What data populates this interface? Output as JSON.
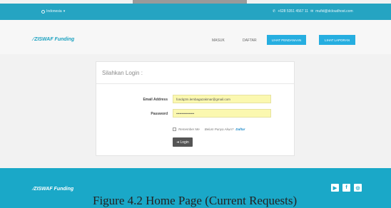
{
  "topbar": {
    "language": "Indonesia",
    "phone": "+628 5351 4567 11",
    "email": "mufid@dcloudhost.com"
  },
  "navbar": {
    "logo": "ZISWAF Funding",
    "links": [
      "MASUK",
      "DAFTAR"
    ],
    "buttons": [
      "LIHAT PENDANAAN",
      "LIHAT LAPORAN"
    ]
  },
  "login": {
    "title": "Silahkan Login :",
    "email_label": "Email Address",
    "email_value": "fondq2m.lembagazakmar@gmail.com",
    "password_label": "Password",
    "password_value": "••••••••••••••••",
    "remember_label": "Remember Me",
    "no_account_text": "Belum Punya Akun?",
    "register_link": "Daftar",
    "login_button": "Login"
  },
  "footer": {
    "logo": "ZISWAF Funding",
    "social_icons": [
      "youtube-icon",
      "facebook-icon",
      "instagram-icon"
    ]
  },
  "caption": "Figure 4.2 Home Page (Current Requests)"
}
